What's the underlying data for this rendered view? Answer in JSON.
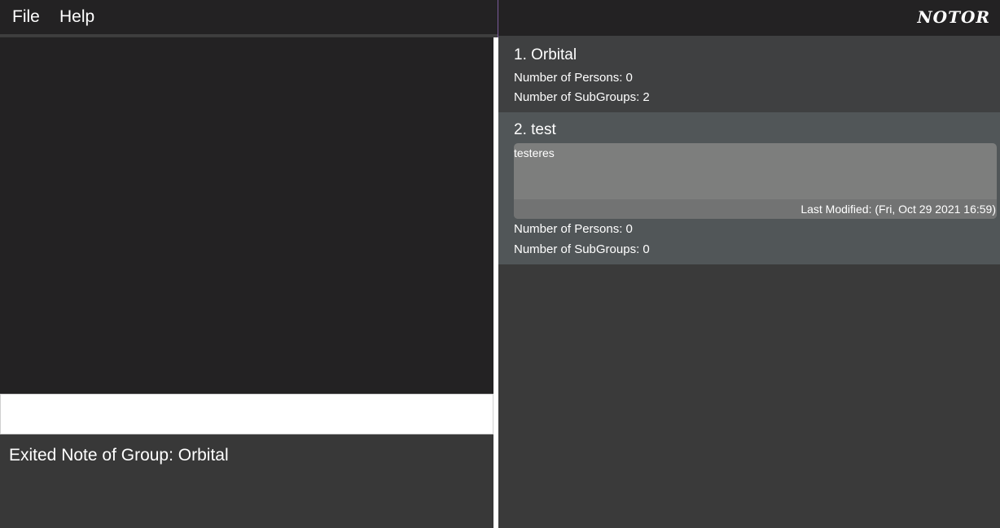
{
  "menu": {
    "file_label": "File",
    "help_label": "Help"
  },
  "app_title": "NOTOR",
  "command_box": {
    "value": ""
  },
  "result_display": {
    "text": "Exited Note of Group: Orbital"
  },
  "groups": [
    {
      "name": "1.  Orbital",
      "persons": "Number of Persons: 0",
      "subgroups": "Number of SubGroups: 2"
    },
    {
      "name": "2.  test",
      "note": "testeres",
      "last_modified": "Last Modified: (Fri, Oct 29 2021 16:59)",
      "persons": "Number of Persons: 0",
      "subgroups": "Number of SubGroups: 0"
    }
  ]
}
